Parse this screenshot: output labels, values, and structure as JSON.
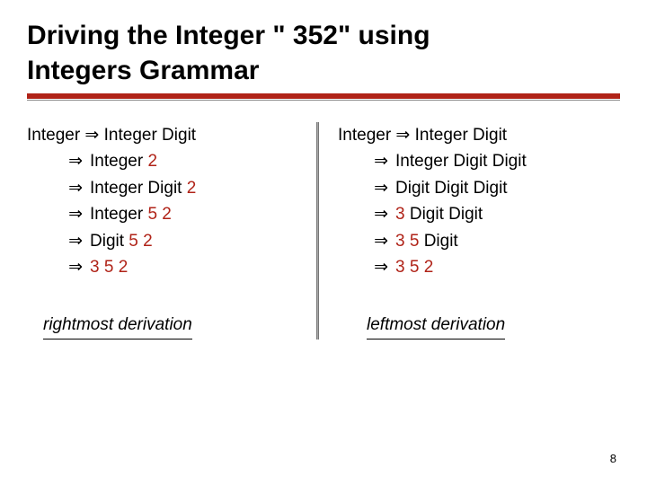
{
  "title_line1": "Driving the Integer \" 352\" using",
  "title_line2": "Integers Grammar",
  "arrow": "⇒",
  "left": {
    "first": "Integer ⇒ Integer Digit",
    "lines": [
      {
        "pre": "Integer ",
        "red": "2",
        "post": ""
      },
      {
        "pre": "Integer Digit ",
        "red": "2",
        "post": ""
      },
      {
        "pre": "Integer ",
        "red": "5 2",
        "post": ""
      },
      {
        "pre": "Digit ",
        "red": "5 2",
        "post": ""
      },
      {
        "pre": "",
        "red": "3 5 2",
        "post": ""
      }
    ],
    "caption": "rightmost derivation"
  },
  "right": {
    "first": "Integer ⇒ Integer Digit",
    "lines": [
      {
        "pre": "Integer Digit Digit",
        "red": "",
        "post": ""
      },
      {
        "pre": "Digit Digit Digit",
        "red": "",
        "post": ""
      },
      {
        "pre": "",
        "red": "3",
        "post": " Digit Digit"
      },
      {
        "pre": "",
        "red": "3 5",
        "post": " Digit"
      },
      {
        "pre": "",
        "red": "3 5 2",
        "post": ""
      }
    ],
    "caption": "leftmost derivation"
  },
  "page_number": "8"
}
